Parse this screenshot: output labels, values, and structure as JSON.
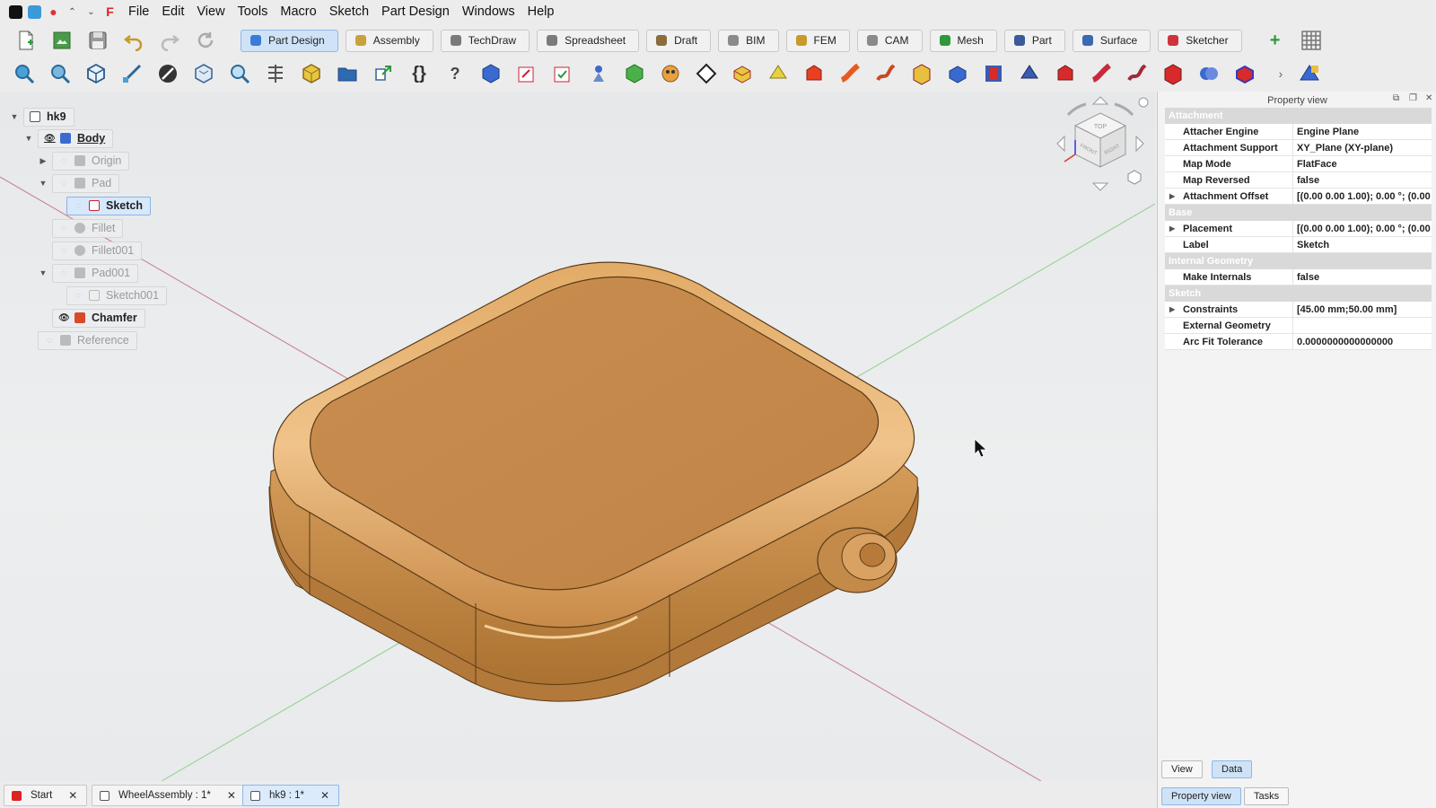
{
  "menubar": {
    "items": [
      "File",
      "Edit",
      "View",
      "Tools",
      "Macro",
      "Sketch",
      "Part Design",
      "Windows",
      "Help"
    ]
  },
  "workbenches": [
    {
      "label": "Part Design",
      "icon": "part-design-icon",
      "color": "#3a7bd5",
      "active": true
    },
    {
      "label": "Assembly",
      "icon": "assembly-icon",
      "color": "#c8a23a",
      "active": false
    },
    {
      "label": "TechDraw",
      "icon": "techdraw-icon",
      "color": "#7a7a7a",
      "active": false
    },
    {
      "label": "Spreadsheet",
      "icon": "spreadsheet-icon",
      "color": "#7a7a7a",
      "active": false
    },
    {
      "label": "Draft",
      "icon": "draft-icon",
      "color": "#8a6d3b",
      "active": false
    },
    {
      "label": "BIM",
      "icon": "bim-icon",
      "color": "#8a8a8a",
      "active": false
    },
    {
      "label": "FEM",
      "icon": "fem-icon",
      "color": "#c89a2a",
      "active": false
    },
    {
      "label": "CAM",
      "icon": "cam-icon",
      "color": "#8a8a8a",
      "active": false
    },
    {
      "label": "Mesh",
      "icon": "mesh-icon",
      "color": "#2d9a3a",
      "active": false
    },
    {
      "label": "Part",
      "icon": "part-icon",
      "color": "#3a5a9a",
      "active": false
    },
    {
      "label": "Surface",
      "icon": "surface-icon",
      "color": "#3a6ab0",
      "active": false
    },
    {
      "label": "Sketcher",
      "icon": "sketcher-icon",
      "color": "#d0343a",
      "active": false
    }
  ],
  "tree": {
    "items": [
      {
        "label": "hk9",
        "icon": "document-icon"
      },
      {
        "label": "Body",
        "icon": "body-icon"
      },
      {
        "label": "Origin",
        "icon": "origin-icon"
      },
      {
        "label": "Pad",
        "icon": "pad-icon"
      },
      {
        "label": "Sketch",
        "icon": "sketch-icon"
      },
      {
        "label": "Fillet",
        "icon": "fillet-icon"
      },
      {
        "label": "Fillet001",
        "icon": "fillet-icon"
      },
      {
        "label": "Pad001",
        "icon": "pad-icon"
      },
      {
        "label": "Sketch001",
        "icon": "sketch-icon"
      },
      {
        "label": "Chamfer",
        "icon": "chamfer-icon"
      },
      {
        "label": "Reference",
        "icon": "reference-icon"
      }
    ]
  },
  "panel": {
    "title": "Property view",
    "groups": [
      {
        "name": "Attachment",
        "props": [
          {
            "name": "Attacher Engine",
            "value": "Engine Plane",
            "expandable": false
          },
          {
            "name": "Attachment Support",
            "value": "XY_Plane (XY-plane)",
            "expandable": false
          },
          {
            "name": "Map Mode",
            "value": "FlatFace",
            "expandable": false
          },
          {
            "name": "Map Reversed",
            "value": "false",
            "expandable": false
          },
          {
            "name": "Attachment Offset",
            "value": "[(0.00 0.00 1.00); 0.00 °; (0.00 ...",
            "expandable": true
          }
        ]
      },
      {
        "name": "Base",
        "props": [
          {
            "name": "Placement",
            "value": "[(0.00 0.00 1.00); 0.00 °; (0.00 ...",
            "expandable": true
          },
          {
            "name": "Label",
            "value": "Sketch",
            "expandable": false
          }
        ]
      },
      {
        "name": "Internal Geometry",
        "props": [
          {
            "name": "Make Internals",
            "value": "false",
            "expandable": false
          }
        ]
      },
      {
        "name": "Sketch",
        "props": [
          {
            "name": "Constraints",
            "value": "[45.00 mm;50.00 mm]",
            "expandable": true
          },
          {
            "name": "External Geometry",
            "value": "",
            "expandable": false
          },
          {
            "name": "Arc Fit Tolerance",
            "value": "0.0000000000000000",
            "expandable": false
          }
        ]
      }
    ],
    "view_tab": "View",
    "data_tab": "Data",
    "bottom_tabs": [
      "Property view",
      "Tasks"
    ]
  },
  "navcube": {
    "faces": [
      "TOP",
      "FRONT",
      "RIGHT"
    ]
  },
  "doc_tabs": [
    {
      "label": "Start",
      "active": false
    },
    {
      "label": "WheelAssembly : 1*",
      "active": false
    },
    {
      "label": "hk9 : 1*",
      "active": true
    }
  ],
  "colors": {
    "model": "#c68a4a",
    "accent": "#3a7bd5"
  }
}
